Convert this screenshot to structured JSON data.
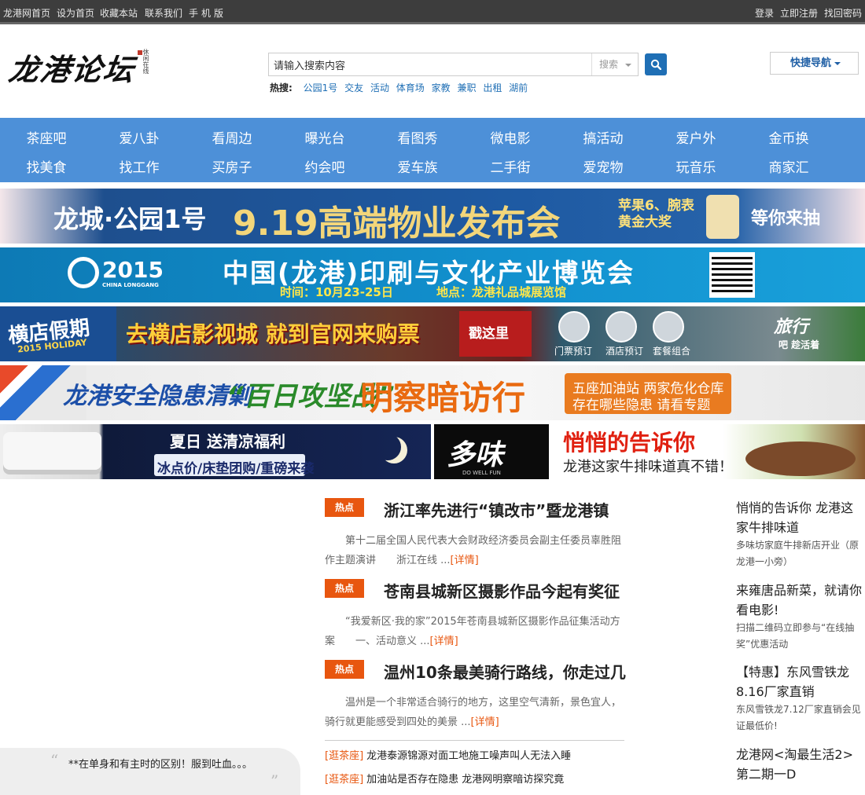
{
  "topbar": {
    "left_links": [
      "龙港网首页",
      "设为首页",
      "收藏本站",
      "联系我们",
      "手机版"
    ],
    "right_links": [
      "登录",
      "立即注册",
      "找回密码"
    ]
  },
  "logo": {
    "text": "龙港论坛",
    "seal_text": "休闲在线"
  },
  "search": {
    "value": "请输入搜索内容",
    "type_label": "搜索",
    "hot_label": "热搜:",
    "hot_words": [
      "公园1号",
      "交友",
      "活动",
      "体育场",
      "家教",
      "兼职",
      "出租",
      "湖前"
    ]
  },
  "quick_nav": {
    "label": "快捷导航"
  },
  "nav": {
    "row1": [
      "茶座吧",
      "爱八卦",
      "看周边",
      "曝光台",
      "看图秀",
      "微电影",
      "搞活动",
      "爱户外",
      "金币换"
    ],
    "row2": [
      "找美食",
      "找工作",
      "买房子",
      "约会吧",
      "爱车族",
      "二手街",
      "爱宠物",
      "玩音乐",
      "商家汇"
    ]
  },
  "banners": {
    "b1": {
      "left": "龙城·公园1号",
      "main": "9.19高端物业发布会",
      "prize_line1": "苹果6、腕表",
      "prize_line2": "黄金大奖",
      "end": "等你来抽"
    },
    "b2": {
      "year": "2015",
      "sub": "CHINA LONGGANG",
      "main": "中国(龙港)印刷与文化产业博览会",
      "time": "时间：10月23-25日",
      "place": "地点：龙港礼品城展览馆"
    },
    "b3": {
      "logo": "横店假期",
      "logo_sub": "2015 HOLIDAY",
      "main": "去横店影视城 就到官网来购票",
      "arrow": "戳这里",
      "labels": [
        "门票预订",
        "酒店预订",
        "套餐组合"
      ],
      "travel": "旅行",
      "travel_sub": "吧 趁活着"
    },
    "b4": {
      "main": "龙港安全隐患清剿",
      "quote": "“百日攻坚战”",
      "big": "明察暗访行",
      "orange1": "五座加油站 两家危化仓库",
      "orange2": "存在哪些隐患 请看专题"
    },
    "b5a": {
      "line1": "夏日 送清凉福利",
      "line2": "冰点价/床垫团购/重磅来袭"
    },
    "b5b": {
      "logo": "多味",
      "sub": "DO WELL FUN"
    },
    "b5c": {
      "line1": "悄悄的告诉你",
      "line2": "龙港这家牛排味道真不错！"
    }
  },
  "quote": {
    "text": "**在单身和有主时的区别！服到吐血。。。"
  },
  "news": [
    {
      "badge": "热点",
      "title": "浙江率先进行“镇改市”暨龙港镇",
      "summary": "　　第十二届全国人民代表大会财政经济委员会副主任委员辜胜阻作主题演讲　　浙江在线 ...",
      "more": "[详情]"
    },
    {
      "badge": "热点",
      "title": "苍南县城新区摄影作品今起有奖征",
      "summary": "　　“我爱新区·我的家”2015年苍南县城新区摄影作品征集活动方案　　一、活动意义 ...",
      "more": "[详情]"
    },
    {
      "badge": "热点",
      "title": "温州10条最美骑行路线，你走过几",
      "summary": "　　温州是一个非常适合骑行的地方，这里空气清新，景色宜人，骑行就更能感受到四处的美景 ...",
      "more": "[详情]"
    }
  ],
  "tea_list": [
    {
      "tag": "[逛茶座]",
      "text": "龙港泰源锦源对面工地施工噪声叫人无法入睡"
    },
    {
      "tag": "[逛茶座]",
      "text": "加油站是否存在隐患 龙港网明察暗访探究竟"
    }
  ],
  "side": [
    {
      "title": "悄悄的告诉你 龙港这家牛排味道",
      "desc": "多味坊家庭牛排新店开业（原龙港一小旁）"
    },
    {
      "title": "来雍唐品新菜，就请你看电影!",
      "desc": "扫描二维码立即参与“在线抽奖”优惠活动"
    },
    {
      "title": "【特惠】东风雪铁龙8.16厂家直销",
      "desc": "东风雪铁龙7.12厂家直销会见证最低价!"
    },
    {
      "title": "龙港网<淘最生活2>第二期一D",
      "desc": ""
    }
  ]
}
